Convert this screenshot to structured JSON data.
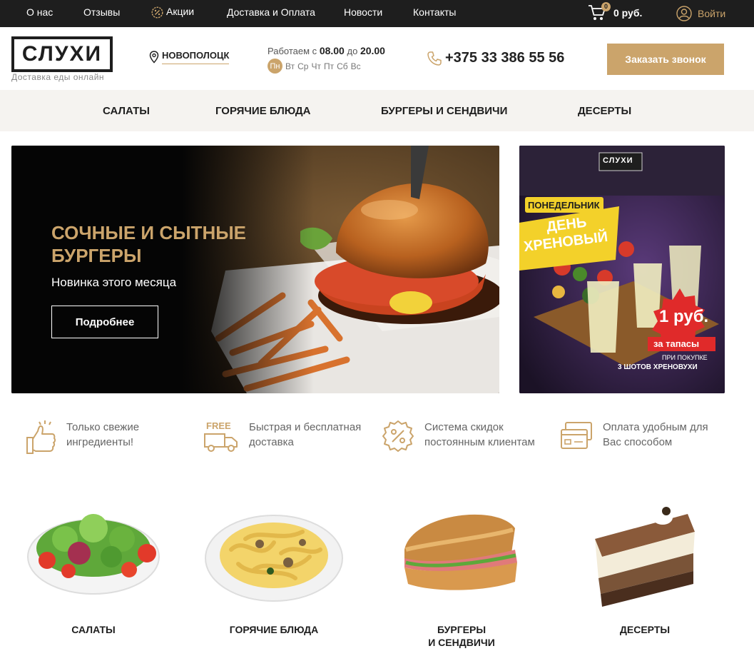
{
  "topbar": {
    "links": [
      "О нас",
      "Отзывы",
      "Акции",
      "Доставка и Оплата",
      "Новости",
      "Контакты"
    ],
    "cart_count": "0",
    "cart_sum": "0 руб.",
    "login": "Войти"
  },
  "header": {
    "logo": "СЛУХИ",
    "logo_sub": "Доставка еды онлайн",
    "city": "НОВОПОЛОЦК",
    "hours_prefix": "Работаем с",
    "hours_from": "08.00",
    "hours_mid": "до",
    "hours_to": "20.00",
    "days_today": "Пн",
    "days_rest": [
      "Вт",
      "Ср",
      "Чт",
      "Пт",
      "Сб",
      "Вс"
    ],
    "phone": "+375 33 386 55 56",
    "call_button": "Заказать звонок"
  },
  "catnav": [
    "САЛАТЫ",
    "ГОРЯЧИЕ БЛЮДА",
    "БУРГЕРЫ И СЕНДВИЧИ",
    "ДЕСЕРТЫ"
  ],
  "hero": {
    "title": "СОЧНЫЕ И СЫТНЫЕ\nБУРГЕРЫ",
    "subtitle": "Новинка этого месяца",
    "button": "Подробнее"
  },
  "promo": {
    "logo": "СЛУХИ",
    "day": "ПОНЕДЕЛЬНИК",
    "title_1": "ДЕНЬ",
    "title_2": "ХРЕНОВЫЙ",
    "price": "1 руб.",
    "price_note": "за тапасы",
    "cond_1": "ПРИ ПОКУПКЕ",
    "cond_2": "3 ШОТОВ ХРЕНОВУХИ"
  },
  "features": [
    {
      "icon": "thumbs-up-icon",
      "text": "Только свежие\nингредиенты!"
    },
    {
      "icon": "free-delivery-truck-icon",
      "text": "Быстрая и бесплатная\nдоставка"
    },
    {
      "icon": "discount-badge-icon",
      "text": "Система скидок\nпостоянным клиентам"
    },
    {
      "icon": "payment-cards-icon",
      "text": "Оплата удобным для\nВас способом"
    }
  ],
  "categories": [
    "САЛАТЫ",
    "ГОРЯЧИЕ БЛЮДА",
    "БУРГЕРЫ\nИ СЕНДВИЧИ",
    "ДЕСЕРТЫ"
  ],
  "colors": {
    "accent": "#cba46b",
    "dark": "#1e1e1e",
    "nav_bg": "#f5f3f0"
  }
}
